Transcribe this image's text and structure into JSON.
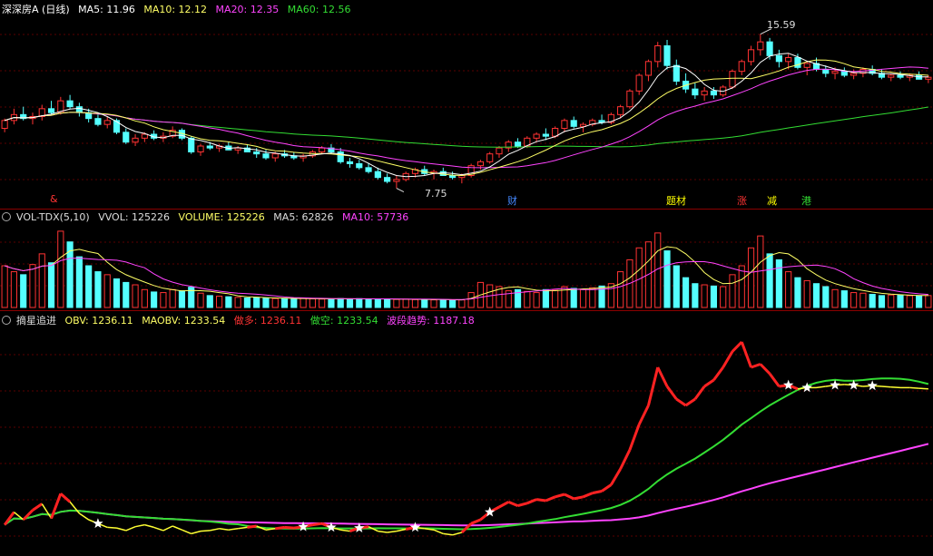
{
  "panel_price": {
    "title": "深深房A (日线)",
    "indicators": [
      {
        "label": "MA5: 11.96",
        "color": "#ffffff"
      },
      {
        "label": "MA10: 12.12",
        "color": "#ffff66"
      },
      {
        "label": "MA20: 12.35",
        "color": "#ff44ff"
      },
      {
        "label": "MA60: 12.56",
        "color": "#33dd33"
      }
    ],
    "high_label": "15.59",
    "low_label": "7.75",
    "events": [
      {
        "text": "&",
        "color": "#ff3333"
      },
      {
        "text": "财",
        "color": "#4488ff"
      },
      {
        "text": "题材",
        "color": "#ffff00"
      },
      {
        "text": "涨",
        "color": "#ff3333"
      },
      {
        "text": "减",
        "color": "#ffff00"
      },
      {
        "text": "港",
        "color": "#33dd33"
      }
    ]
  },
  "panel_volume": {
    "title": "VOL-TDX(5,10)",
    "indicators": [
      {
        "label": "VVOL: 125226",
        "color": "#dddddd"
      },
      {
        "label": "VOLUME: 125226",
        "color": "#ffff66"
      },
      {
        "label": "MA5: 62826",
        "color": "#dddddd"
      },
      {
        "label": "MA10: 57736",
        "color": "#ff44ff"
      }
    ]
  },
  "panel_obv": {
    "title": "摘星追进",
    "indicators": [
      {
        "label": "OBV: 1236.11",
        "color": "#ffff66"
      },
      {
        "label": "MAOBV: 1233.54",
        "color": "#ffff66"
      },
      {
        "label": "做多: 1236.11",
        "color": "#ff3333"
      },
      {
        "label": "做空: 1233.54",
        "color": "#33dd33"
      },
      {
        "label": "波段趋势: 1187.18",
        "color": "#ff44ff"
      }
    ]
  },
  "chart_data": {
    "type": "line",
    "price_range": [
      7.5,
      16.5
    ],
    "ohlc": [
      [
        10.8,
        11.3,
        10.6,
        11.2
      ],
      [
        11.2,
        11.8,
        11.0,
        11.5
      ],
      [
        11.5,
        11.9,
        11.2,
        11.3
      ],
      [
        11.3,
        11.6,
        11.0,
        11.4
      ],
      [
        11.4,
        12.0,
        11.2,
        11.8
      ],
      [
        11.8,
        12.2,
        11.5,
        11.6
      ],
      [
        11.6,
        12.4,
        11.5,
        12.2
      ],
      [
        12.2,
        12.5,
        11.8,
        11.9
      ],
      [
        11.9,
        12.1,
        11.4,
        11.6
      ],
      [
        11.6,
        11.8,
        11.1,
        11.3
      ],
      [
        11.3,
        11.5,
        10.9,
        11.0
      ],
      [
        11.0,
        11.4,
        10.8,
        11.2
      ],
      [
        11.2,
        11.3,
        10.5,
        10.6
      ],
      [
        10.6,
        10.8,
        10.0,
        10.1
      ],
      [
        10.1,
        10.5,
        9.9,
        10.3
      ],
      [
        10.3,
        10.6,
        10.1,
        10.5
      ],
      [
        10.5,
        10.7,
        10.2,
        10.3
      ],
      [
        10.3,
        10.6,
        10.1,
        10.4
      ],
      [
        10.4,
        10.9,
        10.3,
        10.7
      ],
      [
        10.7,
        10.8,
        10.2,
        10.3
      ],
      [
        10.3,
        10.4,
        9.5,
        9.6
      ],
      [
        9.6,
        10.0,
        9.4,
        9.9
      ],
      [
        9.9,
        10.1,
        9.7,
        9.8
      ],
      [
        9.8,
        10.0,
        9.6,
        9.9
      ],
      [
        9.9,
        10.1,
        9.7,
        9.7
      ],
      [
        9.7,
        9.9,
        9.5,
        9.8
      ],
      [
        9.8,
        10.0,
        9.6,
        9.6
      ],
      [
        9.6,
        9.8,
        9.3,
        9.5
      ],
      [
        9.5,
        9.7,
        9.2,
        9.3
      ],
      [
        9.3,
        9.6,
        9.1,
        9.5
      ],
      [
        9.5,
        9.7,
        9.3,
        9.4
      ],
      [
        9.4,
        9.6,
        9.2,
        9.3
      ],
      [
        9.3,
        9.5,
        9.1,
        9.4
      ],
      [
        9.4,
        9.7,
        9.3,
        9.6
      ],
      [
        9.6,
        9.9,
        9.5,
        9.8
      ],
      [
        9.8,
        10.0,
        9.5,
        9.6
      ],
      [
        9.6,
        9.8,
        9.0,
        9.1
      ],
      [
        9.1,
        9.3,
        8.8,
        9.0
      ],
      [
        9.0,
        9.2,
        8.7,
        8.8
      ],
      [
        8.8,
        9.0,
        8.5,
        8.6
      ],
      [
        8.6,
        8.8,
        8.2,
        8.3
      ],
      [
        8.3,
        8.5,
        8.0,
        8.1
      ],
      [
        8.1,
        8.4,
        7.75,
        8.2
      ],
      [
        8.2,
        8.6,
        8.1,
        8.5
      ],
      [
        8.5,
        8.8,
        8.3,
        8.7
      ],
      [
        8.7,
        8.9,
        8.4,
        8.5
      ],
      [
        8.5,
        8.7,
        8.2,
        8.6
      ],
      [
        8.6,
        8.8,
        8.4,
        8.4
      ],
      [
        8.4,
        8.6,
        8.2,
        8.3
      ],
      [
        8.3,
        8.5,
        8.0,
        8.4
      ],
      [
        8.4,
        9.0,
        8.3,
        8.9
      ],
      [
        8.9,
        9.2,
        8.7,
        9.1
      ],
      [
        9.1,
        9.6,
        9.0,
        9.5
      ],
      [
        9.5,
        9.9,
        9.3,
        9.8
      ],
      [
        9.8,
        10.2,
        9.6,
        10.1
      ],
      [
        10.1,
        10.3,
        9.8,
        9.9
      ],
      [
        9.9,
        10.4,
        9.8,
        10.3
      ],
      [
        10.3,
        10.6,
        10.1,
        10.5
      ],
      [
        10.5,
        10.8,
        10.2,
        10.4
      ],
      [
        10.4,
        10.9,
        10.3,
        10.8
      ],
      [
        10.8,
        11.3,
        10.6,
        11.2
      ],
      [
        11.2,
        11.4,
        10.8,
        10.9
      ],
      [
        10.9,
        11.1,
        10.6,
        11.0
      ],
      [
        11.0,
        11.3,
        10.9,
        11.2
      ],
      [
        11.2,
        11.5,
        11.0,
        11.1
      ],
      [
        11.1,
        11.6,
        11.0,
        11.5
      ],
      [
        11.5,
        12.0,
        11.3,
        11.9
      ],
      [
        11.9,
        12.8,
        11.8,
        12.7
      ],
      [
        12.7,
        13.6,
        12.5,
        13.5
      ],
      [
        13.5,
        14.3,
        13.2,
        14.2
      ],
      [
        14.2,
        15.2,
        13.9,
        15.0
      ],
      [
        15.0,
        15.3,
        13.8,
        14.0
      ],
      [
        14.0,
        14.3,
        13.0,
        13.2
      ],
      [
        13.2,
        13.6,
        12.6,
        12.8
      ],
      [
        12.8,
        13.1,
        12.3,
        12.5
      ],
      [
        12.5,
        12.9,
        12.2,
        12.7
      ],
      [
        12.7,
        12.9,
        12.3,
        12.5
      ],
      [
        12.5,
        13.0,
        12.4,
        12.9
      ],
      [
        12.9,
        13.8,
        12.8,
        13.7
      ],
      [
        13.7,
        14.3,
        13.5,
        14.2
      ],
      [
        14.2,
        15.0,
        14.0,
        14.8
      ],
      [
        14.8,
        15.59,
        14.5,
        15.2
      ],
      [
        15.2,
        15.4,
        14.3,
        14.5
      ],
      [
        14.5,
        14.8,
        13.9,
        14.2
      ],
      [
        14.2,
        14.6,
        13.8,
        14.4
      ],
      [
        14.4,
        14.6,
        13.8,
        13.9
      ],
      [
        13.9,
        14.2,
        13.5,
        14.1
      ],
      [
        14.1,
        14.4,
        13.7,
        13.8
      ],
      [
        13.8,
        14.0,
        13.4,
        13.6
      ],
      [
        13.6,
        13.9,
        13.3,
        13.7
      ],
      [
        13.7,
        13.9,
        13.4,
        13.5
      ],
      [
        13.5,
        13.8,
        13.3,
        13.6
      ],
      [
        13.6,
        13.9,
        13.4,
        13.8
      ],
      [
        13.8,
        14.0,
        13.5,
        13.6
      ],
      [
        13.6,
        13.8,
        13.3,
        13.4
      ],
      [
        13.4,
        13.6,
        13.2,
        13.5
      ],
      [
        13.5,
        13.7,
        13.3,
        13.4
      ],
      [
        13.4,
        13.6,
        13.2,
        13.5
      ],
      [
        13.5,
        13.7,
        13.3,
        13.3
      ],
      [
        13.3,
        13.5,
        13.1,
        13.4
      ]
    ],
    "volume_range": [
      0,
      140000
    ],
    "volume": [
      70000,
      60000,
      55000,
      72000,
      90000,
      75000,
      128000,
      110000,
      85000,
      70000,
      60000,
      55000,
      48000,
      42000,
      38000,
      30000,
      26000,
      25000,
      30000,
      28000,
      34000,
      24000,
      20000,
      19000,
      18000,
      17000,
      16000,
      16500,
      15500,
      15000,
      14800,
      14500,
      15200,
      14600,
      14100,
      14000,
      15000,
      14500,
      14800,
      14300,
      14000,
      13800,
      13500,
      14000,
      13200,
      13000,
      12800,
      13000,
      12500,
      12800,
      25000,
      42000,
      38000,
      35000,
      28000,
      30000,
      27000,
      25000,
      30000,
      29000,
      35000,
      32000,
      30000,
      33000,
      36000,
      40000,
      60000,
      80000,
      100000,
      110000,
      125000,
      95000,
      70000,
      50000,
      40000,
      38000,
      36000,
      35000,
      55000,
      70000,
      100000,
      120000,
      90000,
      80000,
      60000,
      50000,
      45000,
      40000,
      35000,
      30000,
      28000,
      25000,
      24000,
      22000,
      20000,
      21000,
      20500,
      19800,
      19500,
      20000
    ],
    "obv_range": [
      980,
      1330
    ],
    "obv": [
      1022,
      1042,
      1030,
      1045,
      1055,
      1032,
      1071,
      1058,
      1040,
      1030,
      1024,
      1018,
      1017,
      1013,
      1019,
      1022,
      1018,
      1013,
      1020,
      1014,
      1008,
      1012,
      1013,
      1016,
      1014,
      1016,
      1018,
      1020,
      1014,
      1016,
      1018,
      1017,
      1019,
      1022,
      1024,
      1018,
      1014,
      1012,
      1017,
      1019,
      1012,
      1010,
      1012,
      1015,
      1018,
      1016,
      1014,
      1008,
      1006,
      1010,
      1024,
      1030,
      1042,
      1050,
      1058,
      1052,
      1056,
      1062,
      1060,
      1066,
      1070,
      1063,
      1066,
      1072,
      1075,
      1085,
      1110,
      1140,
      1180,
      1210,
      1270,
      1240,
      1220,
      1210,
      1220,
      1240,
      1250,
      1270,
      1295,
      1310,
      1270,
      1275,
      1260,
      1240,
      1242,
      1236,
      1238,
      1238,
      1240,
      1242,
      1243,
      1242,
      1240,
      1241,
      1240,
      1239,
      1238,
      1238,
      1237,
      1236
    ],
    "star_indices": [
      10,
      32,
      35,
      38,
      44,
      52,
      84,
      86,
      89,
      91,
      93
    ]
  }
}
